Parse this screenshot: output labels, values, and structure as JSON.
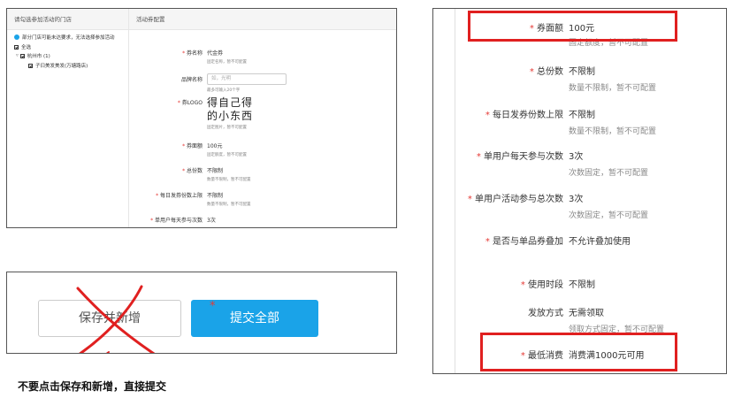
{
  "panel1": {
    "left_header": "请勾选参加活动的门店",
    "note": "部分门店可能未达要求，无法选择参加活动",
    "select_all": "全选",
    "city": "杭州市 (1)",
    "store": "子曰美发美发(万塘路店)",
    "right_header": "活动券配置",
    "fields": [
      {
        "label": "券名称",
        "required": true,
        "value": "代金券",
        "hint": "固定名称，暂不可配置"
      },
      {
        "label": "品牌名称",
        "required": false,
        "placeholder": "如，光明",
        "hint": "最多可输入20个字"
      },
      {
        "label": "券LOGO",
        "required": true,
        "logo_line1": "得自己得",
        "logo_line2": "的小东西",
        "hint": "固定图片，暂不可配置"
      },
      {
        "label": "券面额",
        "required": true,
        "value": "100元",
        "hint": "固定额度，暂不可配置"
      },
      {
        "label": "总份数",
        "required": true,
        "value": "不限制",
        "hint": "数量不限制，暂不可配置"
      },
      {
        "label": "每日发券份数上限",
        "required": true,
        "value": "不限制",
        "hint": "数量不限制，暂不可配置"
      },
      {
        "label": "单用户每天参与次数",
        "required": true,
        "value": "3次",
        "hint": ""
      }
    ]
  },
  "panel2": {
    "fields": [
      {
        "label": "券面额",
        "required": true,
        "value": "100元",
        "hint": "固定额度，暂不可配置"
      },
      {
        "label": "总份数",
        "required": true,
        "value": "不限制",
        "hint": "数量不限制，暂不可配置"
      },
      {
        "label": "每日发券份数上限",
        "required": true,
        "value": "不限制",
        "hint": "数量不限制，暂不可配置"
      },
      {
        "label": "单用户每天参与次数",
        "required": true,
        "value": "3次",
        "hint": "次数固定，暂不可配置"
      },
      {
        "label": "单用户活动参与总次数",
        "required": true,
        "value": "3次",
        "hint": "次数固定，暂不可配置"
      },
      {
        "label": "是否与单品券叠加",
        "required": true,
        "value": "不允许叠加使用",
        "hint": ""
      },
      {
        "label": "使用时段",
        "required": true,
        "value": "不限制",
        "hint": ""
      },
      {
        "label": "发放方式",
        "required": false,
        "value": "无需领取",
        "hint": "领取方式固定，暂不可配置"
      },
      {
        "label": "最低消费",
        "required": true,
        "value": "消费满1000元可用",
        "hint": ""
      }
    ],
    "highlight_color": "#e02020"
  },
  "panel3": {
    "save_new_label": "保存并新增",
    "submit_label": "提交全部",
    "asterisk": "*",
    "submit_color": "#1aa3e8"
  },
  "instruction": "不要点击保存和新增，直接提交"
}
